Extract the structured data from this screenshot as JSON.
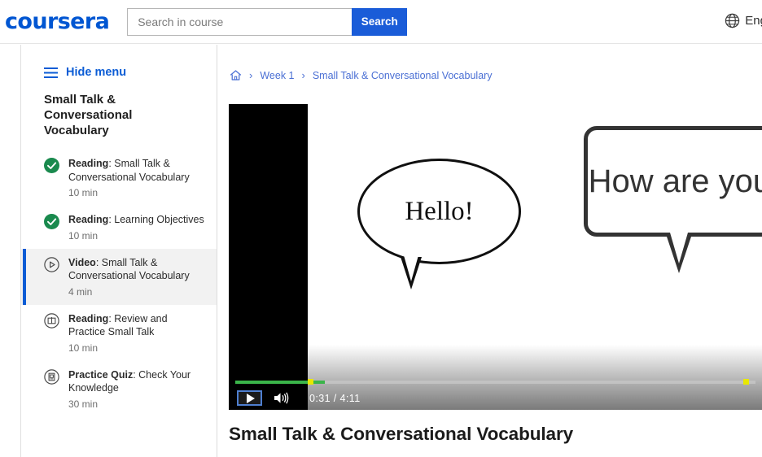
{
  "header": {
    "logo": "coursera",
    "search": {
      "value": "",
      "placeholder": "Search in course"
    },
    "search_button": "Search",
    "language": "Eng",
    "globe_icon": "globe-icon"
  },
  "sidebar": {
    "hide_menu": "Hide menu",
    "hamburger_icon": "hamburger-icon",
    "course_title": "Small Talk & Conversational Vocabulary",
    "items": [
      {
        "kind": "Reading",
        "title": "Small Talk & Conversational Vocabulary",
        "duration": "10 min",
        "icon": "check-circle-icon",
        "state": "completed"
      },
      {
        "kind": "Reading",
        "title": "Learning Objectives",
        "duration": "10 min",
        "icon": "check-circle-icon",
        "state": "completed"
      },
      {
        "kind": "Video",
        "title": "Small Talk & Conversational Vocabulary",
        "duration": "4 min",
        "icon": "play-circle-icon",
        "state": "active"
      },
      {
        "kind": "Reading",
        "title": "Review and Practice Small Talk",
        "duration": "10 min",
        "icon": "book-circle-icon",
        "state": "default"
      },
      {
        "kind": "Practice Quiz",
        "title": "Check Your Knowledge",
        "duration": "30 min",
        "icon": "quiz-circle-icon",
        "state": "default"
      }
    ]
  },
  "breadcrumb": {
    "home_icon": "home-icon",
    "separator": "›",
    "items": [
      "Week 1",
      "Small Talk & Conversational Vocabulary"
    ]
  },
  "player": {
    "bubble_left_text": "Hello!",
    "bubble_right_text": "How are you?",
    "play_icon": "play-icon",
    "volume_icon": "volume-icon",
    "current_time": "0:31",
    "total_time": "4:11",
    "time_separator": "/",
    "time_display": "0:31  /  4:11",
    "progress_percent": 13
  },
  "main": {
    "video_title": "Small Talk & Conversational Vocabulary"
  },
  "colors": {
    "brand_blue": "#0056d2",
    "button_blue": "#1a5cd8",
    "breadcrumb_blue": "#4a6fd4",
    "complete_green": "#1a8a4e",
    "progress_green": "#3bb54a",
    "marker_yellow": "#e8e800"
  }
}
